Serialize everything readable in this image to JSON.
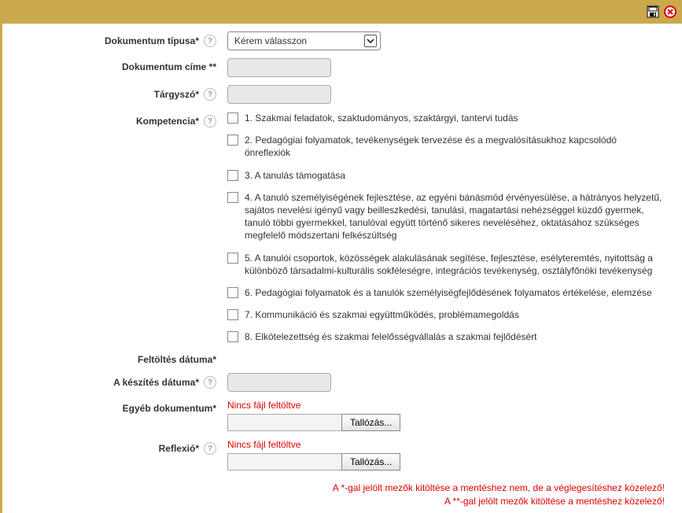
{
  "toolbar": {
    "save_title": "Mentés",
    "cancel_title": "Mégse"
  },
  "labels": {
    "doc_type": "Dokumentum típusa*",
    "doc_title": "Dokumentum címe **",
    "subject": "Tárgyszó*",
    "competence": "Kompetencia*",
    "upload_date": "Feltöltés dátuma*",
    "create_date": "A készítés dátuma*",
    "other_doc": "Egyéb dokumentum*",
    "reflection": "Reflexió*"
  },
  "select": {
    "placeholder": "Kérem válasszon"
  },
  "competences": [
    "1. Szakmai feladatok, szaktudományos, szaktárgyi, tantervi tudás",
    "2. Pedagógiai folyamatok, tevékenységek tervezése és a megvalósításukhoz kapcsolódó önreflexiók",
    "3. A tanulás támogatása",
    "4. A tanuló személyiségének fejlesztése, az egyéni bánásmód érvényesülése, a hátrányos helyzetű, sajátos nevelési igényű vagy beilleszkedési, tanulási, magatartási nehézséggel küzdő gyermek, tanuló többi gyermekkel, tanulóval együtt történő sikeres neveléséhez, oktatásához szükséges megfelelő módszertani felkészültség",
    "5. A tanulói csoportok, közösségek alakulásának segítése, fejlesztése, esélyteremtés, nyitottság a különböző társadalmi-kulturális sokféleségre, integrációs tevékenység, osztályfőnöki tevékenység",
    "6. Pedagógiai folyamatok és a tanulók személyiségfejlődésének folyamatos értékelése, elemzése",
    "7. Kommunikáció és szakmai együttműködés, problémamegoldás",
    "8. Elkötelezettség és szakmai felelősségvállalás a szakmai fejlődésért"
  ],
  "file": {
    "no_file": "Nincs fájl feltöltve",
    "browse": "Tallózás..."
  },
  "notes": {
    "line1": "A *-gal jelölt mezők kitöltése a mentéshez nem, de a véglegesítéshez közelező!",
    "line2": "A **-gal jelölt mezők kitöltése a mentéshez közelező!"
  },
  "help_glyph": "?"
}
